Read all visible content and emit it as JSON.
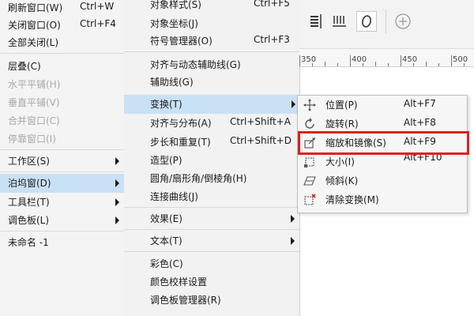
{
  "menu_left": {
    "items": [
      {
        "label": "刷新窗口(W)",
        "shortcut": "Ctrl+W"
      },
      {
        "label": "关闭窗口(O)",
        "shortcut": "Ctrl+F4"
      },
      {
        "label": "全部关闭(L)"
      },
      {
        "label": "层叠(C)"
      },
      {
        "label": "水平平铺(H)"
      },
      {
        "label": "垂直平铺(V)"
      },
      {
        "label": "合并窗口(C)"
      },
      {
        "label": "停靠窗口(I)"
      },
      {
        "label": "工作区(S)"
      },
      {
        "label": "泊坞窗(D)"
      },
      {
        "label": "工具栏(T)"
      },
      {
        "label": "调色板(L)"
      },
      {
        "label": "未命名 -1"
      }
    ]
  },
  "menu_view": {
    "items": [
      {
        "label": "对象样式(S)",
        "shortcut": "Ctrl+F5"
      },
      {
        "label": "对象坐标(J)"
      },
      {
        "label": "符号管理器(O)",
        "shortcut": "Ctrl+F3"
      },
      {
        "label": "对齐与动态辅助线(G)"
      },
      {
        "label": "辅助线(G)"
      },
      {
        "label": "变换(T)"
      },
      {
        "label": "对齐与分布(A)",
        "shortcut": "Ctrl+Shift+A"
      },
      {
        "label": "步长和重复(T)",
        "shortcut": "Ctrl+Shift+D"
      },
      {
        "label": "造型(P)"
      },
      {
        "label": "圆角/扇形角/倒棱角(H)"
      },
      {
        "label": "连接曲线(J)"
      },
      {
        "label": "效果(E)"
      },
      {
        "label": "文本(T)"
      },
      {
        "label": "彩色(C)"
      },
      {
        "label": "颜色校样设置"
      },
      {
        "label": "调色板管理器(R)"
      }
    ]
  },
  "submenu_transform": {
    "items": [
      {
        "label": "位置(P)",
        "shortcut": "Alt+F7",
        "icon": "position-icon"
      },
      {
        "label": "旋转(R)",
        "shortcut": "Alt+F8",
        "icon": "rotate-icon"
      },
      {
        "label": "缩放和镜像(S)",
        "shortcut": "Alt+F9",
        "icon": "scale-mirror-icon"
      },
      {
        "label": "大小(I)",
        "shortcut": "Alt+F10",
        "icon": "size-icon"
      },
      {
        "label": "倾斜(K)",
        "icon": "skew-icon"
      },
      {
        "label": "清除变换(M)",
        "icon": "clear-transform-icon"
      }
    ]
  },
  "ruler": {
    "labels": [
      "350",
      "400",
      "450",
      "500"
    ]
  },
  "colors": {
    "highlight": "#c9e1f5",
    "annotation_box": "#e02020",
    "menu_bg": "#f4f4f4"
  }
}
